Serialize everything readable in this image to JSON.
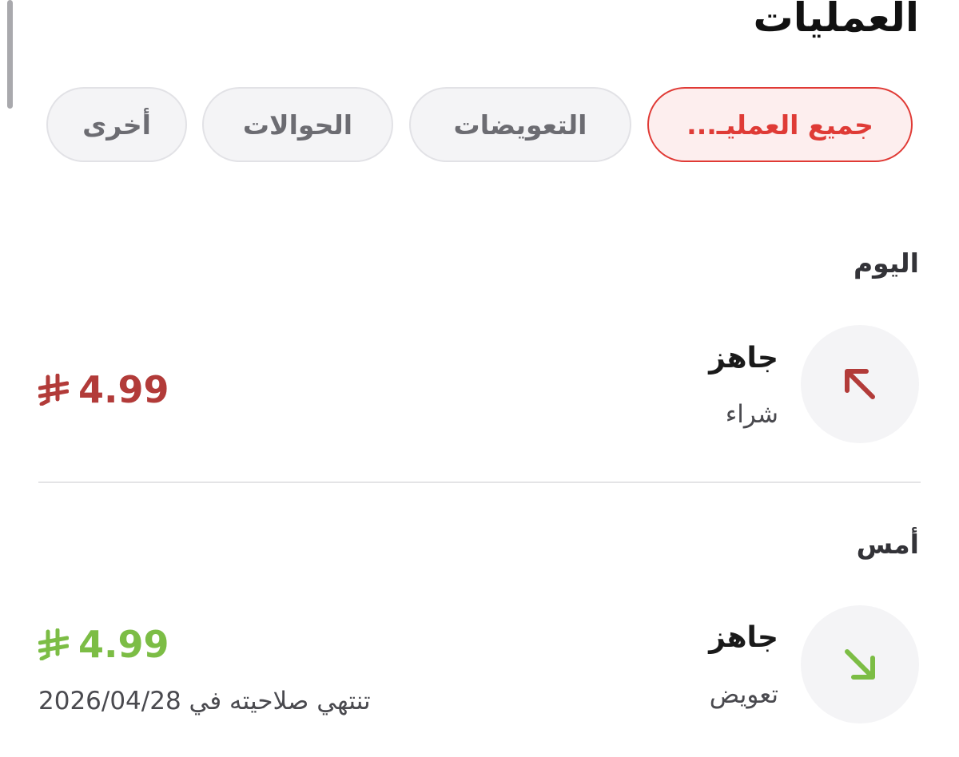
{
  "header": {
    "title": "العمليات"
  },
  "filters": [
    {
      "label": "جميع العمليـ...",
      "active": true
    },
    {
      "label": "التعويضات",
      "active": false
    },
    {
      "label": "الحوالات",
      "active": false
    },
    {
      "label": "أخرى",
      "active": false
    }
  ],
  "sections": [
    {
      "label": "اليوم",
      "transactions": [
        {
          "merchant": "جاهز",
          "type": "شراء",
          "amount": "4.99",
          "direction": "outgoing",
          "icon": "arrow-up-left-icon",
          "color": "#b23b39"
        }
      ]
    },
    {
      "label": "أمس",
      "transactions": [
        {
          "merchant": "جاهز",
          "type": "تعويض",
          "amount": "4.99",
          "direction": "incoming",
          "icon": "arrow-down-right-icon",
          "color": "#7cbd45",
          "expiry": "تنتهي صلاحيته في 2026/04/28"
        }
      ]
    }
  ],
  "currency_icon": "saudi-riyal-icon",
  "colors": {
    "accent": "#e03a35",
    "debit": "#b23b39",
    "credit": "#7cbd45"
  }
}
